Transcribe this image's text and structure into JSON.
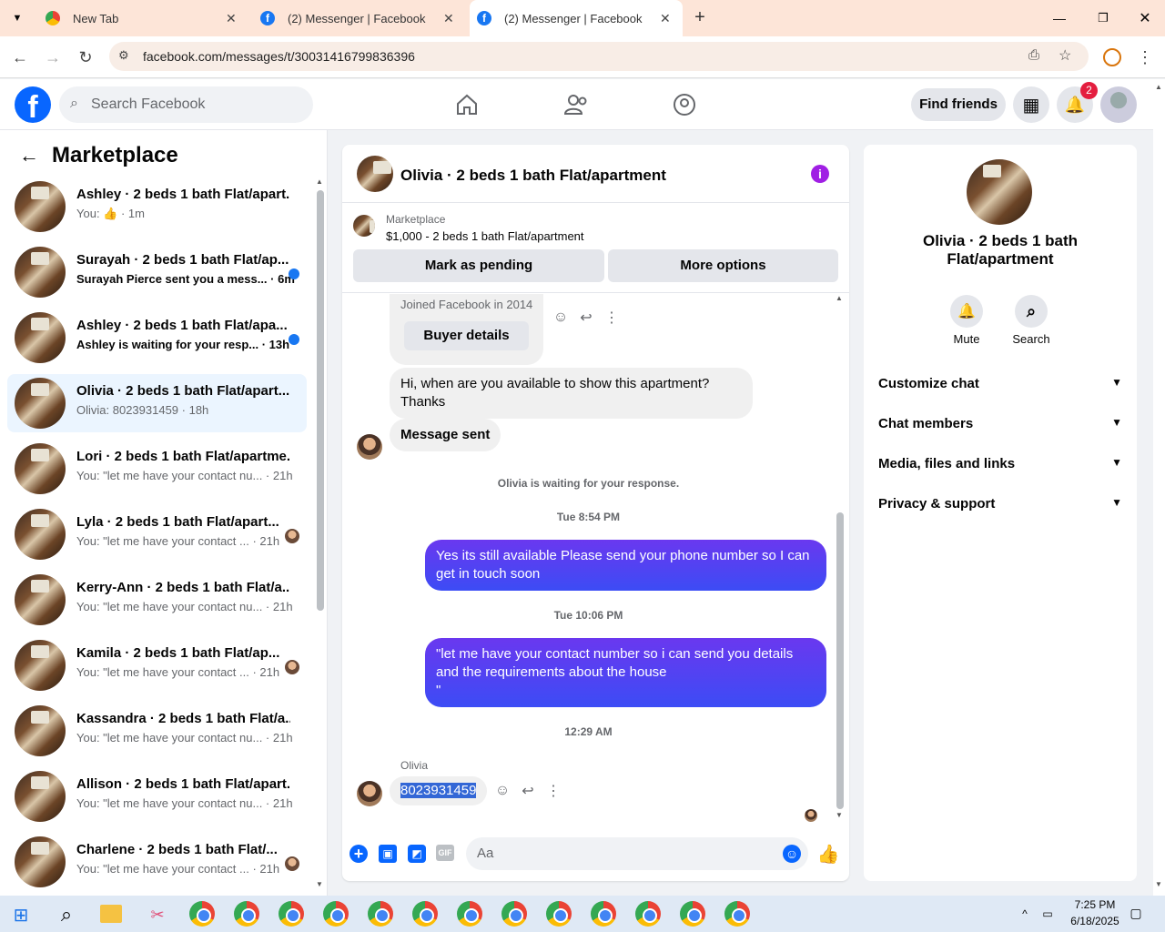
{
  "browser": {
    "tabs": [
      {
        "title": "New Tab"
      },
      {
        "title": "(2) Messenger | Facebook"
      },
      {
        "title": "(2) Messenger | Facebook"
      }
    ],
    "url": "facebook.com/messages/t/30031416799836396"
  },
  "fb": {
    "search_placeholder": "Search Facebook",
    "find_friends": "Find friends",
    "notif_count": "2"
  },
  "sidebar": {
    "title": "Marketplace",
    "items": [
      {
        "name": "Ashley · 2 beds 1 bath Flat/apart...",
        "sub": "You: 👍 · 1m",
        "unread": false,
        "marker": "none"
      },
      {
        "name": "Surayah · 2 beds 1 bath Flat/ap...",
        "sub": "Surayah Pierce sent you a mess... · 6m",
        "unread": true,
        "marker": "dot"
      },
      {
        "name": "Ashley · 2 beds 1 bath Flat/apa...",
        "sub": "Ashley is waiting for your resp... · 13h",
        "unread": true,
        "marker": "dot"
      },
      {
        "name": "Olivia · 2 beds 1 bath Flat/apart...",
        "sub": "Olivia: 8023931459 · 18h",
        "unread": false,
        "marker": "none"
      },
      {
        "name": "Lori · 2 beds 1 bath Flat/apartme...",
        "sub": "You: \"let me have your contact nu... · 21h",
        "unread": false,
        "marker": "none"
      },
      {
        "name": "Lyla · 2 beds 1 bath Flat/apart...",
        "sub": "You: \"let me have your contact ... · 21h",
        "unread": false,
        "marker": "avatar"
      },
      {
        "name": "Kerry-Ann · 2 beds 1 bath Flat/a...",
        "sub": "You: \"let me have your contact nu... · 21h",
        "unread": false,
        "marker": "none"
      },
      {
        "name": "Kamila · 2 beds 1 bath Flat/ap...",
        "sub": "You: \"let me have your contact ... · 21h",
        "unread": false,
        "marker": "avatar"
      },
      {
        "name": "Kassandra · 2 beds 1 bath Flat/a...",
        "sub": "You: \"let me have your contact nu... · 21h",
        "unread": false,
        "marker": "none"
      },
      {
        "name": "Allison · 2 beds 1 bath Flat/apart...",
        "sub": "You: \"let me have your contact nu... · 21h",
        "unread": false,
        "marker": "none"
      },
      {
        "name": "Charlene · 2 beds 1 bath Flat/...",
        "sub": "You: \"let me have your contact ... · 21h",
        "unread": false,
        "marker": "avatar"
      }
    ]
  },
  "chat": {
    "title": "Olivia · 2 beds 1 bath Flat/apartment",
    "listing_label": "Marketplace",
    "listing_desc": "$1,000 - 2 beds 1 bath Flat/apartment",
    "mark_pending": "Mark as pending",
    "more_options": "More options",
    "joined": "Joined Facebook in 2014",
    "buyer_details": "Buyer details",
    "msg1": "Hi, when are you available to show this apartment? Thanks",
    "msg_sent": "Message sent",
    "waiting": "Olivia is waiting for your response.",
    "ts1": "Tue 8:54 PM",
    "out1": "Yes its still available Please send your phone number so I can get in touch soon",
    "ts2": "Tue 10:06 PM",
    "out2_line1": "\"let me have your contact number so i can send you details and the requirements about the house",
    "out2_line2": "\"",
    "ts3": "12:29 AM",
    "sender": "Olivia",
    "phone": "8023931459",
    "composer_placeholder": "Aa"
  },
  "info": {
    "title": "Olivia · 2 beds 1 bath Flat/apartment",
    "mute": "Mute",
    "search": "Search",
    "rows": [
      "Customize chat",
      "Chat members",
      "Media, files and links",
      "Privacy & support"
    ]
  },
  "taskbar": {
    "time": "7:25 PM",
    "date": "6/18/2025"
  }
}
